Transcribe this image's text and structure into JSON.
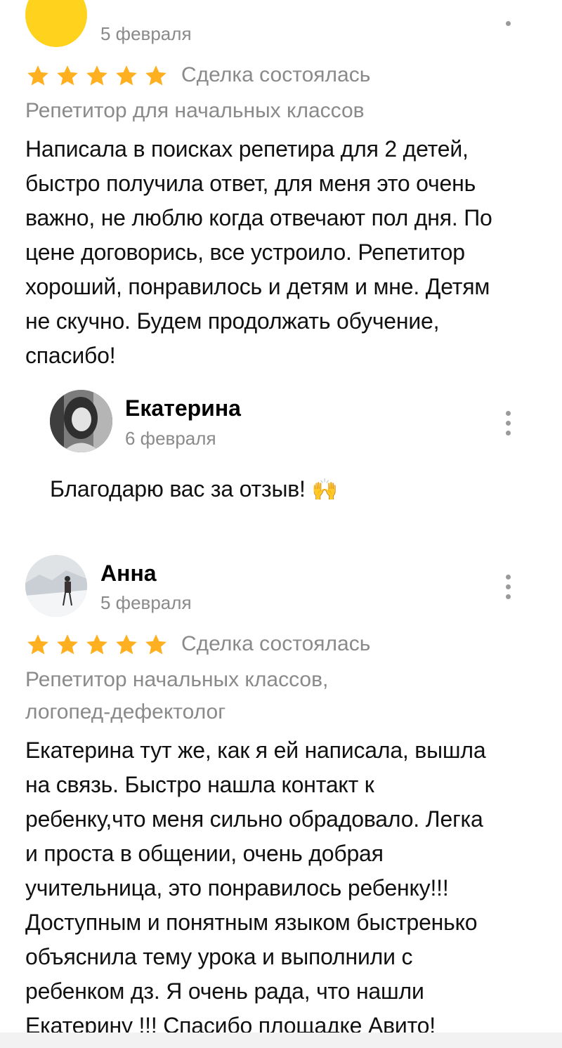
{
  "review1": {
    "date": "5 февраля",
    "deal_status": "Сделка состоялась",
    "rating": 5,
    "category": "Репетитор для начальных классов",
    "text_lines": [
      "Написала в поисках репетира для 2 детей,",
      "быстро получила ответ, для меня это очень",
      "важно, не люблю когда отвечают пол дня. По",
      "цене договорись, все устроило. Репетитор",
      "хороший, понравилось и детям и мне. Детям",
      "не скучно. Будем продолжать обучение,",
      "спасибо!"
    ]
  },
  "reply": {
    "name": "Екатерина",
    "date": "6 февраля",
    "text": "Благодарю вас за отзыв!",
    "emoji": "🙌"
  },
  "review2": {
    "name": "Анна",
    "date": "5 февраля",
    "deal_status": "Сделка состоялась",
    "rating": 5,
    "category_lines": [
      "Репетитор начальных классов,",
      "логопед-дефектолог"
    ],
    "text_lines": [
      "Екатерина тут же, как я ей написала, вышла",
      "на связь. Быстро нашла контакт к",
      "ребенку,что меня сильно обрадовало. Легка",
      "и проста в общении, очень добрая",
      "учительница, это понравилось ребенку!!!",
      "Доступным и понятным языком быстренько",
      "объяснила тему урока и выполнили с",
      "ребенком дз. Я очень рада, что нашли",
      "Екатерину !!! Спасибо площадке Авито!"
    ]
  },
  "colors": {
    "star": "#FFB021",
    "avatar_yellow": "#FFD21E",
    "muted_text": "#8a8a8a"
  },
  "icons": {
    "star": "star-icon",
    "menu": "kebab-menu-icon"
  }
}
